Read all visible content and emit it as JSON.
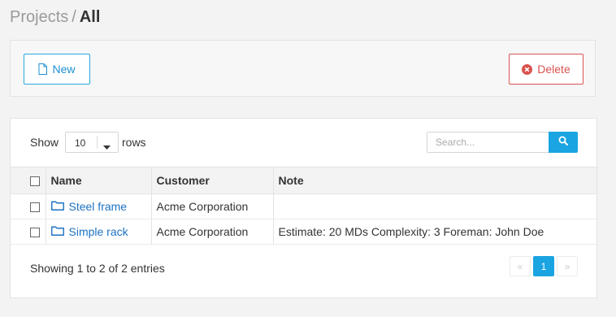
{
  "breadcrumb": {
    "parent": "Projects",
    "separator": "/",
    "current": "All"
  },
  "toolbar": {
    "new_label": "New",
    "new_icon": "file-icon",
    "delete_label": "Delete",
    "delete_icon": "times-circle-icon"
  },
  "table_controls": {
    "show_label": "Show",
    "rows_value": "10",
    "rows_label": "rows",
    "search_placeholder": "Search...",
    "search_icon": "search-icon"
  },
  "table": {
    "columns": [
      "Name",
      "Customer",
      "Note"
    ],
    "rows": [
      {
        "name": "Steel frame",
        "customer": "Acme Corporation",
        "note": ""
      },
      {
        "name": "Simple rack",
        "customer": "Acme Corporation",
        "note": "Estimate: 20 MDs Complexity: 3 Foreman: John Doe"
      }
    ]
  },
  "footer": {
    "info": "Showing 1 to 2 of 2 entries",
    "pagination": {
      "prev": "«",
      "current": "1",
      "next": "»"
    }
  },
  "colors": {
    "accent": "#1aa4e1",
    "danger": "#d9534f",
    "link": "#1d72c2"
  }
}
